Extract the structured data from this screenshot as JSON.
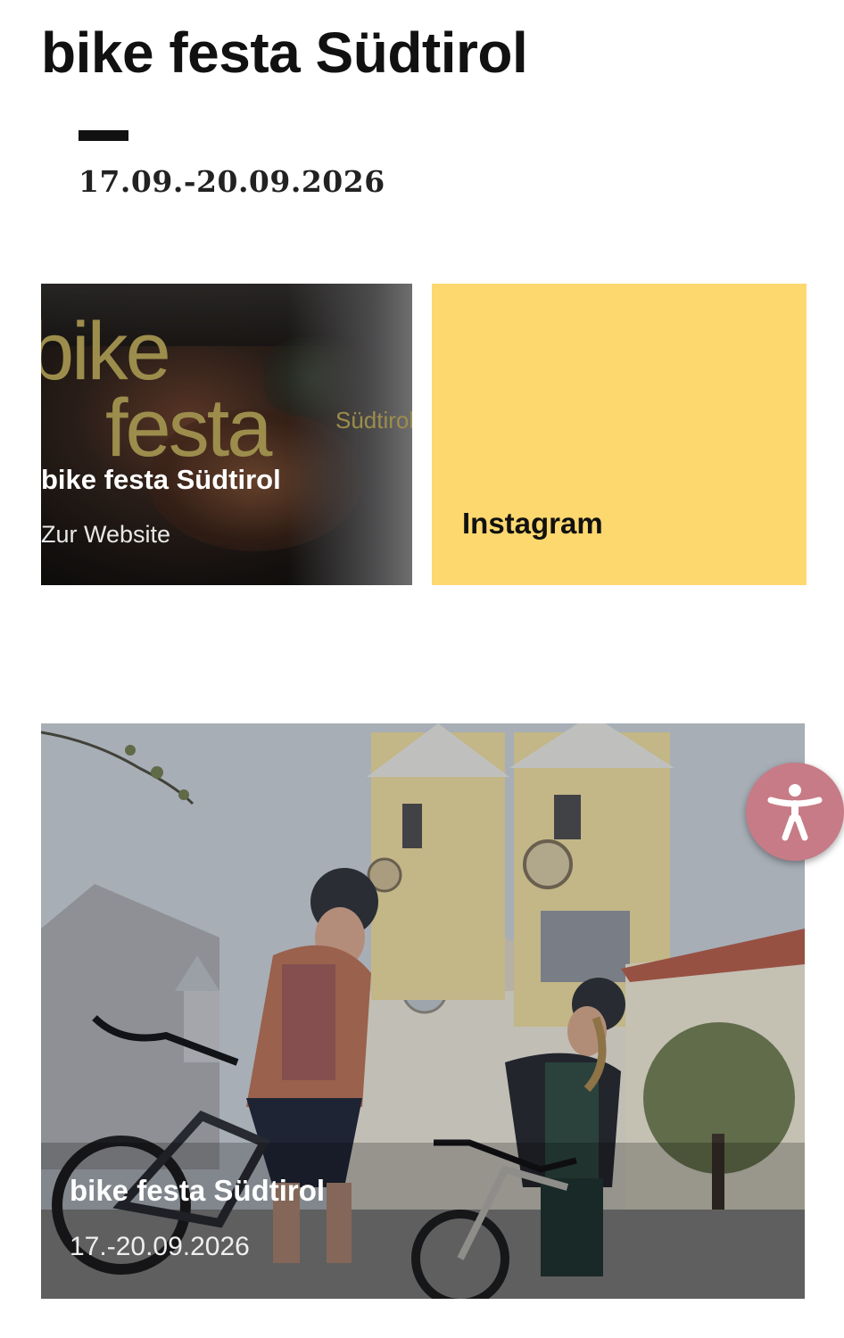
{
  "header": {
    "title": "bike festa Südtirol",
    "date": "17.09.-20.09.2026"
  },
  "cards": {
    "website": {
      "logo_word1": "bike",
      "logo_word2": "festa",
      "logo_word3": "Südtirol",
      "title": "bike festa Südtirol",
      "link": "Zur Website"
    },
    "instagram": {
      "label": "Instagram",
      "color": "#fdd86e"
    },
    "photo": {
      "title": "bike festa Südtirol",
      "date": "17.-20.09.2026"
    }
  },
  "accessibility": {
    "icon": "accessibility-person-icon",
    "color": "#c77b86"
  }
}
